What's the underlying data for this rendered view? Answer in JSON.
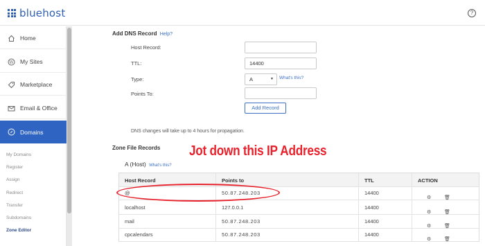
{
  "brand": {
    "name": "bluehost",
    "color": "#2f5fb3"
  },
  "header": {
    "help_icon": "?"
  },
  "sidebar": {
    "items": [
      {
        "label": "Home",
        "icon": "home-icon"
      },
      {
        "label": "My Sites",
        "icon": "wordpress-icon"
      },
      {
        "label": "Marketplace",
        "icon": "tag-icon"
      },
      {
        "label": "Email & Office",
        "icon": "envelope-icon"
      },
      {
        "label": "Domains",
        "icon": "compass-icon",
        "active": true
      }
    ],
    "subitems": [
      "My Domains",
      "Register",
      "Assign",
      "Redirect",
      "Transfer",
      "Subdomains",
      "Zone Editor"
    ]
  },
  "add_dns": {
    "title": "Add DNS Record",
    "help": "Help?",
    "host_label": "Host Record:",
    "ttl_label": "TTL:",
    "ttl_value": "14400",
    "type_label": "Type:",
    "type_value": "A",
    "whats_this": "What's this?",
    "points_label": "Points To:",
    "button": "Add Record",
    "note": "DNS changes will take up to 4 hours for propagation."
  },
  "zone": {
    "title": "Zone File Records",
    "subtitle": "A (Host)",
    "subtitle_help": "What's this?",
    "columns": [
      "Host Record",
      "Points to",
      "TTL",
      "ACTION"
    ],
    "rows": [
      {
        "host": "@",
        "points": "50.87.248.203",
        "ttl": "14400"
      },
      {
        "host": "localhost",
        "points": "127.0.0.1",
        "ttl": "14400"
      },
      {
        "host": "mail",
        "points": "50.87.248.203",
        "ttl": "14400"
      },
      {
        "host": "cpcalendars",
        "points": "50.87.248.203",
        "ttl": "14400"
      }
    ]
  },
  "annotation": {
    "text": "Jot down this IP Address",
    "color": "#e8222c"
  }
}
